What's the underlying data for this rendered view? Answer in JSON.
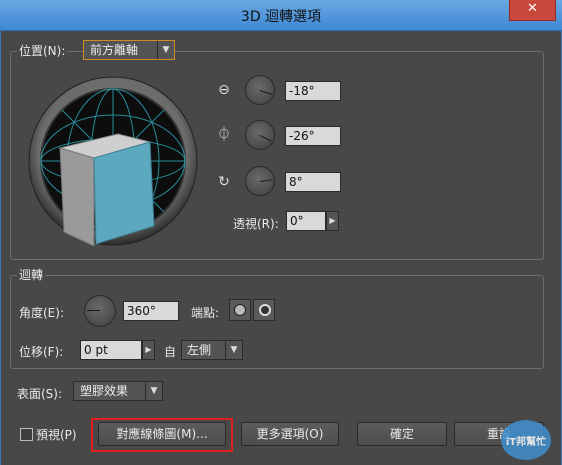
{
  "window": {
    "title": "3D 迴轉選項",
    "close_glyph": "✕"
  },
  "position": {
    "label": "位置(N):",
    "preset": "前方離軸"
  },
  "rotation_inputs": [
    {
      "axis": "x",
      "value": "-18°"
    },
    {
      "axis": "y",
      "value": "-26°"
    },
    {
      "axis": "z",
      "value": "8°"
    }
  ],
  "perspective": {
    "label": "透視(R):",
    "value": "0°"
  },
  "revolve": {
    "section_label": "迴轉",
    "angle_label": "角度(E):",
    "angle_value": "360°",
    "cap_label": "端點:",
    "offset_label": "位移(F):",
    "offset_value": "0 pt",
    "from_label": "自",
    "from_value": "左側"
  },
  "surface": {
    "label": "表面(S):",
    "value": "塑膠效果"
  },
  "footer": {
    "preview_label": "預視(P)",
    "map_art_button": "對應線條圖(M)...",
    "more_options_button": "更多選項(O)",
    "ok_button": "確定",
    "cancel_button": "重設"
  },
  "watermark": {
    "text": "iT邦幫忙"
  },
  "colors": {
    "cube_front": "#5ba8bf",
    "cube_top": "#cfcfcf",
    "cube_side": "#9a9a9a",
    "grid": "#2fb7c8",
    "highlight": "#e02020",
    "titlebar": "#4d95dc"
  },
  "icons": {
    "x_axis": "x-rotate-icon",
    "y_axis": "y-rotate-icon",
    "z_axis": "z-rotate-icon"
  }
}
